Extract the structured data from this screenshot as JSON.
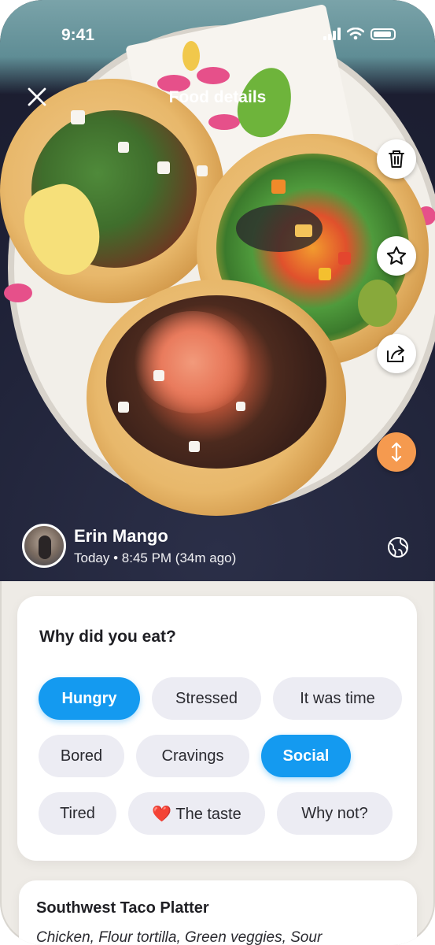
{
  "status_bar": {
    "time": "9:41"
  },
  "header": {
    "title": "Food details"
  },
  "actions": [
    "trash-icon",
    "star-icon",
    "share-icon",
    "sort-icon"
  ],
  "user": {
    "name": "Erin Mango",
    "timestamp": "Today • 8:45 PM (34m ago)"
  },
  "question": {
    "title": "Why did you eat?",
    "options": [
      {
        "label": "Hungry",
        "selected": true
      },
      {
        "label": "Stressed",
        "selected": false
      },
      {
        "label": "It was time",
        "selected": false
      },
      {
        "label": "Bored",
        "selected": false
      },
      {
        "label": "Cravings",
        "selected": false
      },
      {
        "label": "Social",
        "selected": true
      },
      {
        "label": "Tired",
        "selected": false
      },
      {
        "label": "❤️ The taste",
        "selected": false
      },
      {
        "label": "Why not?",
        "selected": false
      }
    ]
  },
  "meal": {
    "title": "Southwest Taco Platter",
    "description": "Chicken, Flour tortilla, Green veggies, Sour"
  },
  "colors": {
    "accent": "#149af0",
    "orange": "#f59a4f"
  }
}
